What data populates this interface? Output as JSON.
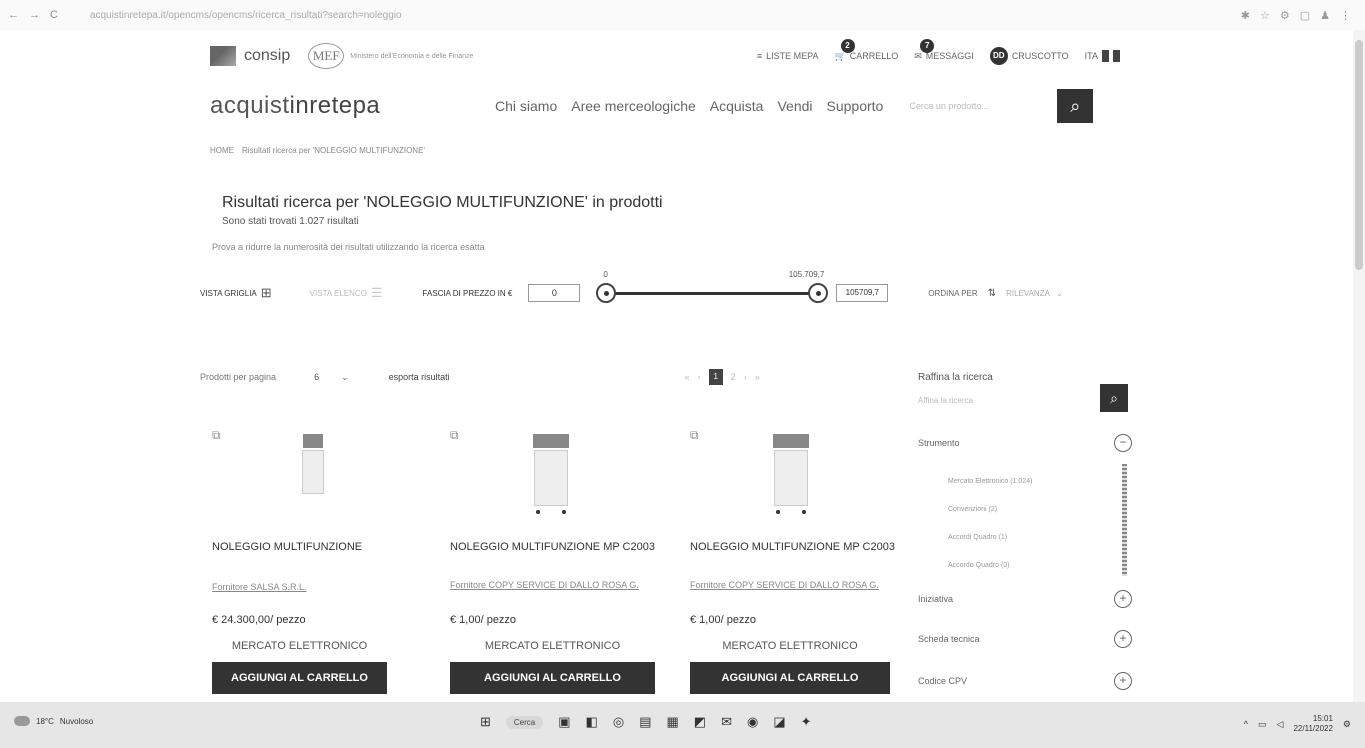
{
  "browser": {
    "url": "acquistinretepa.it/opencms/opencms/ricerca_risultati?search=noleggio"
  },
  "utility": {
    "consip_label": "consip",
    "mef_label": "MEF",
    "mef_subtitle": "Ministero dell'Economia e delle Finanze",
    "links": [
      {
        "label": "LISTE MEPA",
        "icon": "list-icon"
      },
      {
        "label": "CARRELLO",
        "icon": "cart-icon",
        "badge": "2"
      },
      {
        "label": "MESSAGGI",
        "icon": "mail-icon",
        "badge": "7"
      },
      {
        "label": "CRUSCOTTO",
        "icon": "avatar",
        "avatar_initials": "DD"
      }
    ],
    "language": "ITA"
  },
  "header": {
    "brand_prefix": "acquist",
    "brand_bold": "inretepa",
    "menu": [
      "Chi siamo",
      "Aree merceologiche",
      "Acquista",
      "Vendi",
      "Supporto"
    ],
    "search_placeholder": "Cerca un prodotto..."
  },
  "breadcrumb": {
    "home": "HOME",
    "current": "Risultati ricerca per 'NOLEGGIO MULTIFUNZIONE'"
  },
  "results": {
    "title": "Risultati ricerca per 'NOLEGGIO MULTIFUNZIONE' in prodotti",
    "count_text": "Sono stati trovati 1.027 risultati",
    "hint": "Prova a ridurre la numerosità dei risultati utilizzando la ricerca esatta"
  },
  "filters": {
    "grid_label": "VISTA GRIGLIA",
    "list_label": "VISTA ELENCO",
    "price_label": "FASCIA DI PREZZO IN €",
    "price_min_value": "0",
    "slider_min_label": "0",
    "slider_max_label": "105.709,7",
    "price_max_value": "105709,7",
    "sort_label": "ORDINA PER",
    "sort_value": "RILEVANZA"
  },
  "controls": {
    "per_page_label": "Prodotti per pagina",
    "per_page_value": "6",
    "export_label": "esporta risultati",
    "pages": [
      "«",
      "‹",
      "1",
      "2",
      "›",
      "»"
    ],
    "current_page": "1"
  },
  "products": [
    {
      "name": "NOLEGGIO MULTIFUNZIONE",
      "supplier": "Fornitore SALSA S.R.L.",
      "price": "€ 24.300,00/ pezzo",
      "market": "MERCATO ELETTRONICO",
      "button": "AGGIUNGI AL CARRELLO"
    },
    {
      "name": "NOLEGGIO MULTIFUNZIONE MP C2003",
      "supplier": "Fornitore COPY SERVICE DI DALLO ROSA G.",
      "price": "€ 1,00/ pezzo",
      "market": "MERCATO ELETTRONICO",
      "button": "AGGIUNGI AL CARRELLO"
    },
    {
      "name": "NOLEGGIO MULTIFUNZIONE MP C2003",
      "supplier": "Fornitore COPY SERVICE DI DALLO ROSA G.",
      "price": "€ 1,00/ pezzo",
      "market": "MERCATO ELETTRONICO",
      "button": "AGGIUNGI AL CARRELLO"
    }
  ],
  "refine": {
    "title": "Raffina la ricerca",
    "placeholder": "Affina la ricerca",
    "facets": [
      {
        "label": "Strumento",
        "toggle": "−"
      },
      {
        "label": "Iniziativa",
        "toggle": "+"
      },
      {
        "label": "Scheda tecnica",
        "toggle": "+"
      },
      {
        "label": "Codice CPV",
        "toggle": "+"
      }
    ],
    "strumento_options": [
      "Mercato Elettronico (1.024)",
      "Convenzioni (2)",
      "Accordi Quadro (1)",
      "Accordo Quadro (0)"
    ]
  },
  "taskbar": {
    "weather_temp": "18°C",
    "weather_desc": "Nuvoloso",
    "search_label": "Cerca",
    "time": "15:01",
    "date": "22/11/2022"
  }
}
